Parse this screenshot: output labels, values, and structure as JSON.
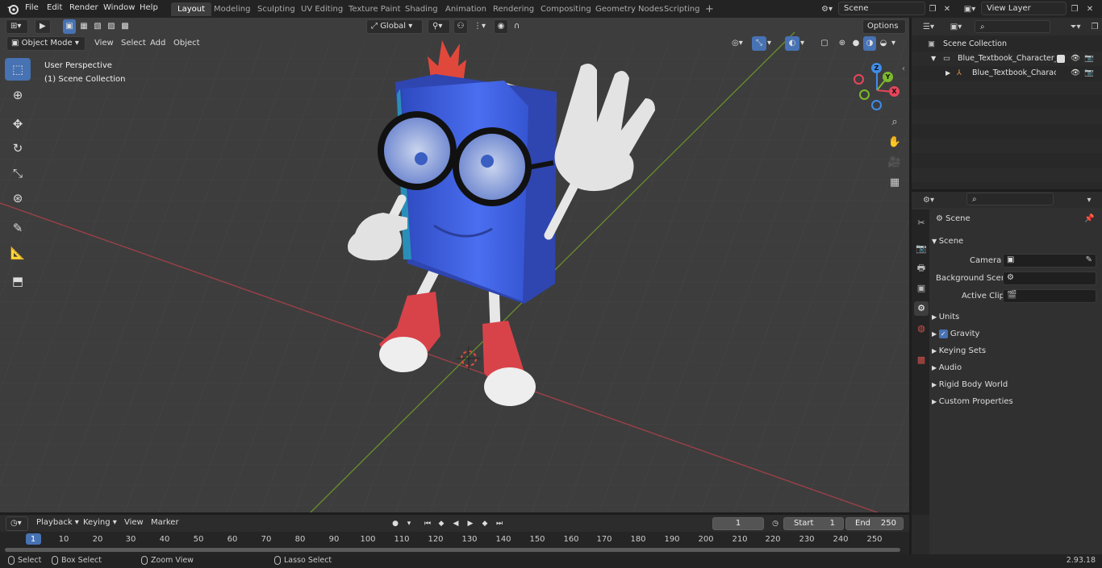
{
  "topbar": {
    "menus": [
      "File",
      "Edit",
      "Render",
      "Window",
      "Help"
    ],
    "workspaces": [
      "Layout",
      "Modeling",
      "Sculpting",
      "UV Editing",
      "Texture Paint",
      "Shading",
      "Animation",
      "Rendering",
      "Compositing",
      "Geometry Nodes",
      "Scripting"
    ],
    "active_workspace": "Layout",
    "add_tab": "+",
    "scene": "Scene",
    "view_layer": "View Layer"
  },
  "viewport": {
    "transform_orientation": "Global",
    "options_label": "Options",
    "mode": "Object Mode",
    "menus": [
      "View",
      "Select",
      "Add",
      "Object"
    ],
    "overlay_view": "User Perspective",
    "overlay_collection": "(1) Scene Collection"
  },
  "outliner": {
    "rows": [
      {
        "label": "Scene Collection"
      },
      {
        "label": "Blue_Textbook_Character_Wa"
      },
      {
        "label": "Blue_Textbook_Characte"
      }
    ]
  },
  "properties": {
    "context": "Scene",
    "panel_title": "Scene",
    "fields": [
      {
        "label": "Camera"
      },
      {
        "label": "Background Scene"
      },
      {
        "label": "Active Clip"
      }
    ],
    "panels": [
      "Units",
      "Gravity",
      "Keying Sets",
      "Audio",
      "Rigid Body World",
      "Custom Properties"
    ],
    "gravity_enabled": true
  },
  "timeline": {
    "menus": [
      "Playback",
      "Keying",
      "View",
      "Marker"
    ],
    "current_frame": "1",
    "start_label": "Start",
    "start": "1",
    "end_label": "End",
    "end": "250",
    "ticks": [
      "1",
      "10",
      "20",
      "30",
      "40",
      "50",
      "60",
      "70",
      "80",
      "90",
      "100",
      "110",
      "120",
      "130",
      "140",
      "150",
      "160",
      "170",
      "180",
      "190",
      "200",
      "210",
      "220",
      "230",
      "240",
      "250"
    ]
  },
  "statusbar": {
    "select": "Select",
    "box_select": "Box Select",
    "zoom_view": "Zoom View",
    "lasso_select": "Lasso Select",
    "version": "2.93.18"
  },
  "colors": {
    "accent": "#4772b3",
    "x_axis": "#e8455a",
    "y_axis": "#7cba2c",
    "z_axis": "#3f8ce8",
    "book_blue": "#3f63d8"
  }
}
